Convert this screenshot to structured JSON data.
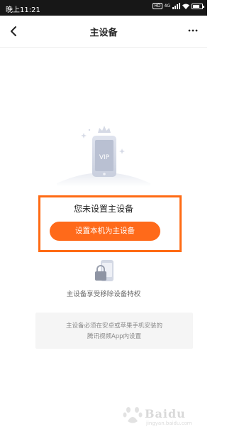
{
  "status_bar": {
    "time": "晚上11:21",
    "hd_badge": "HD",
    "network": "4G"
  },
  "nav": {
    "title": "主设备",
    "back_icon": "chevron-left-icon",
    "more_icon": "more-icon"
  },
  "main": {
    "illustration_label": "VIP",
    "no_device_text": "您未设置主设备",
    "set_button_label": "设置本机为主设备",
    "privilege_text": "主设备享受移除设备特权",
    "info_line1": "主设备必须在安卓或苹果手机安装的",
    "info_line2": "腾讯视频App内设置"
  },
  "watermark": {
    "text": "Baidu",
    "sub": "jingyan.baidu.com"
  },
  "colors": {
    "accent": "#ff6a1a",
    "highlight_border": "#ff6a13",
    "status_bar_bg": "#171717"
  }
}
